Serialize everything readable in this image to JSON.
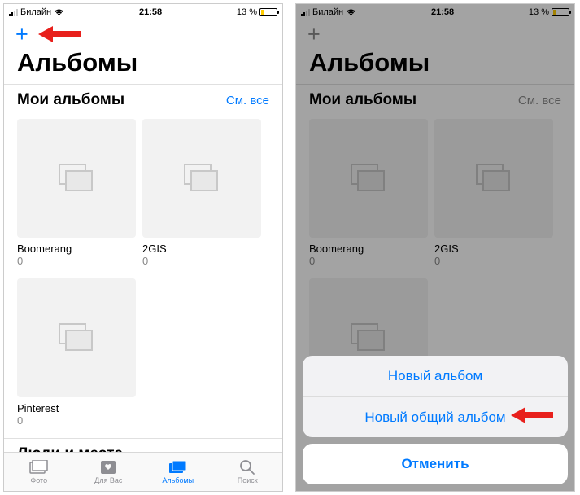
{
  "status": {
    "carrier": "Билайн",
    "time": "21:58",
    "battery_pct": "13 %"
  },
  "left": {
    "title": "Альбомы",
    "sections": {
      "my": {
        "title": "Мои альбомы",
        "see_all": "См. все"
      },
      "people": {
        "title": "Люди и места"
      }
    },
    "albums": [
      {
        "name": "Boomerang",
        "count": "0"
      },
      {
        "name": "2GIS",
        "count": "0"
      },
      {
        "name": "Pinterest",
        "count": "0"
      }
    ],
    "tabs": {
      "photos": "Фото",
      "for_you": "Для Вас",
      "albums": "Альбомы",
      "search": "Поиск"
    }
  },
  "right": {
    "title": "Альбомы",
    "sections": {
      "my": {
        "title": "Мои альбомы",
        "see_all": "См. все"
      }
    },
    "albums": [
      {
        "name": "Boomerang",
        "count": "0"
      },
      {
        "name": "2GIS",
        "count": "0"
      }
    ],
    "sheet": {
      "new_album": "Новый альбом",
      "new_shared": "Новый общий альбом",
      "cancel": "Отменить"
    }
  }
}
